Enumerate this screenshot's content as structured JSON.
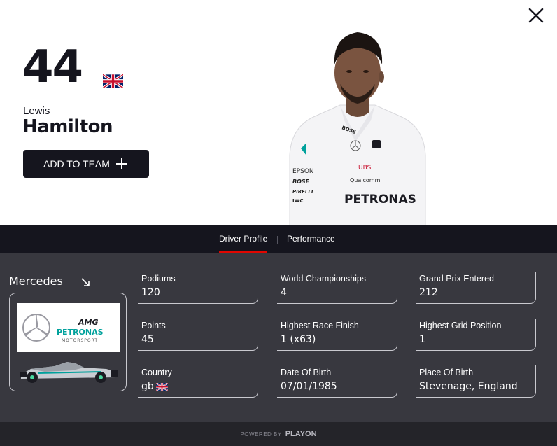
{
  "driver": {
    "number": "44",
    "first_name": "Lewis",
    "last_name": "Hamilton",
    "flag_icon": "uk-flag-icon"
  },
  "actions": {
    "add_to_team_label": "ADD TO TEAM"
  },
  "tabs": [
    {
      "label": "Driver Profile",
      "active": true
    },
    {
      "label": "Performance",
      "active": false
    }
  ],
  "team": {
    "name": "Mercedes",
    "logo_text": {
      "amg": "AMG",
      "petronas": "PETRONAS",
      "motorsport": "MOTORSPORT"
    }
  },
  "portrait_text": {
    "boss": "BOSS",
    "epson": "EPSON",
    "bose": "BOSE",
    "pirelli": "PIRELLI",
    "iwc": "IWC",
    "ubs": "UBS",
    "qualcomm": "Qualcomm",
    "petronas": "PETRONAS"
  },
  "stats": {
    "podiums": {
      "label": "Podiums",
      "value": "120"
    },
    "world_championships": {
      "label": "World Championships",
      "value": "4"
    },
    "grand_prix_entered": {
      "label": "Grand Prix Entered",
      "value": "212"
    },
    "points": {
      "label": "Points",
      "value": "45"
    },
    "highest_race_finish": {
      "label": "Highest Race Finish",
      "value": "1 (x63)"
    },
    "highest_grid_position": {
      "label": "Highest Grid Position",
      "value": "1"
    },
    "country": {
      "label": "Country",
      "value": "gb"
    },
    "date_of_birth": {
      "label": "Date Of Birth",
      "value": "07/01/1985"
    },
    "place_of_birth": {
      "label": "Place Of Birth",
      "value": "Stevenage, England"
    }
  },
  "footer": {
    "powered_by": "POWERED BY",
    "brand": "PLAYON"
  },
  "colors": {
    "dark": "#15151e",
    "panel": "#38383f",
    "footer": "#242429",
    "accent_red": "#e10600",
    "mercedes_teal": "#00a19c"
  }
}
